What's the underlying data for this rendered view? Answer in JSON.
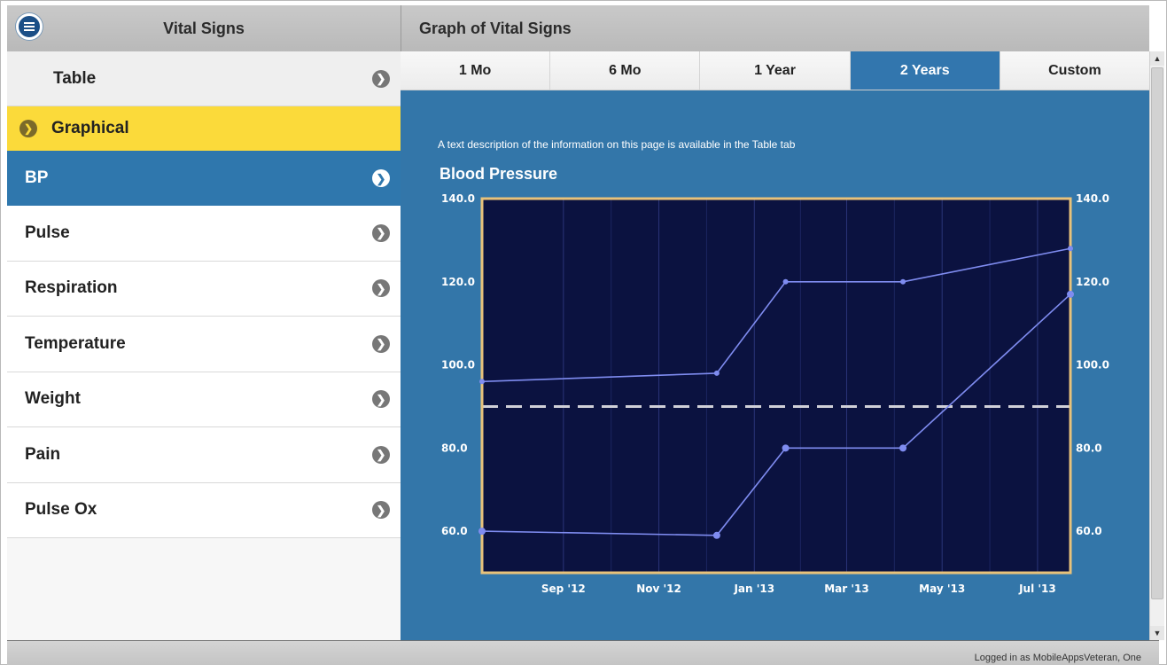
{
  "left_panel": {
    "title": "Vital Signs",
    "table_label": "Table",
    "graphical_label": "Graphical",
    "items": [
      {
        "label": "BP",
        "selected": true
      },
      {
        "label": "Pulse"
      },
      {
        "label": "Respiration"
      },
      {
        "label": "Temperature"
      },
      {
        "label": "Weight"
      },
      {
        "label": "Pain"
      },
      {
        "label": "Pulse Ox"
      }
    ]
  },
  "right_panel": {
    "title": "Graph of Vital Signs",
    "tabs": [
      "1 Mo",
      "6 Mo",
      "1 Year",
      "2 Years",
      "Custom"
    ],
    "active_tab": "2 Years",
    "description": "A text description of the information on this page is available in the Table tab"
  },
  "footer": {
    "logged_in_text": "Logged in as MobileAppsVeteran, One"
  },
  "colors": {
    "accent_blue": "#3276ae",
    "highlight_yellow": "#fbda3a",
    "chart_bg": "#0b1240",
    "chart_border": "#e8c27a",
    "series_line": "#7f8cf0",
    "threshold_line": "#d0d0d8"
  },
  "icons": {
    "menu": "menu-icon",
    "chevron_right": "chevron-right-icon",
    "chevron_down": "chevron-down-icon"
  },
  "chart_data": {
    "type": "line",
    "title": "Blood Pressure",
    "ylim": [
      50,
      140
    ],
    "y_ticks": [
      "140.0",
      "120.0",
      "100.0",
      "80.0",
      "60.0"
    ],
    "y_tick_values": [
      140,
      120,
      100,
      80,
      60
    ],
    "x_ticks": [
      "Sep '12",
      "Nov '12",
      "Jan '13",
      "Mar '13",
      "May '13",
      "Jul '13"
    ],
    "x_tick_dates": [
      "2012-09-01",
      "2012-11-01",
      "2013-01-01",
      "2013-03-01",
      "2013-05-01",
      "2013-07-01"
    ],
    "xlim": [
      "2012-07-11",
      "2013-07-22"
    ],
    "grid": true,
    "threshold": 90,
    "series": [
      {
        "points": [
          {
            "x": "2012-07-11",
            "y": 96
          },
          {
            "x": "2012-12-08",
            "y": 98
          },
          {
            "x": "2013-01-21",
            "y": 120
          },
          {
            "x": "2013-04-06",
            "y": 120
          },
          {
            "x": "2013-07-22",
            "y": 128
          }
        ]
      },
      {
        "points": [
          {
            "x": "2012-07-11",
            "y": 60
          },
          {
            "x": "2012-12-08",
            "y": 59
          },
          {
            "x": "2013-01-21",
            "y": 80
          },
          {
            "x": "2013-04-06",
            "y": 80
          },
          {
            "x": "2013-07-22",
            "y": 117
          }
        ]
      }
    ]
  }
}
